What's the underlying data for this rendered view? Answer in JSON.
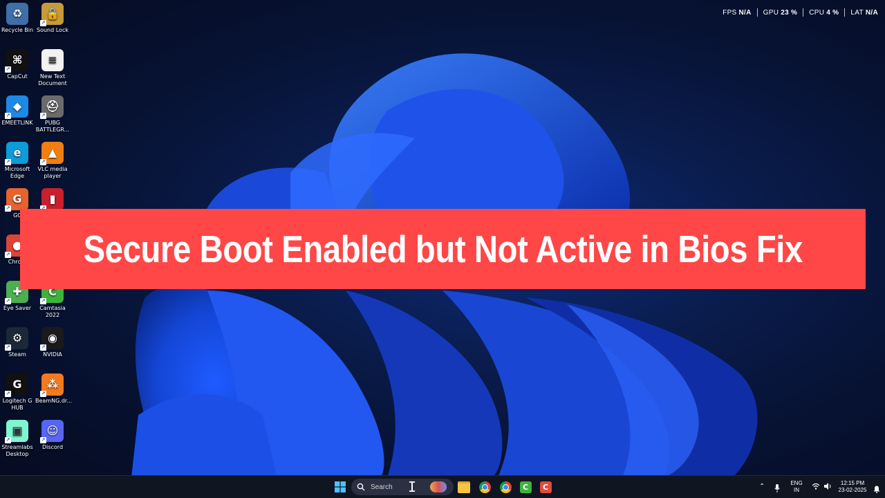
{
  "desktop": {
    "icons": [
      {
        "label": "Recycle Bin",
        "icon": "recycle-bin-icon",
        "color": "#3f6ea8"
      },
      {
        "label": "Sound Lock",
        "icon": "lock-icon",
        "color": "#c79a3a"
      },
      {
        "label": "CapCut",
        "icon": "capcut-icon",
        "color": "#111111"
      },
      {
        "label": "New Text Document",
        "icon": "text-document-icon",
        "color": "#f2f2f2"
      },
      {
        "label": "EMEETLINK",
        "icon": "emeetlink-icon",
        "color": "#1e88e5"
      },
      {
        "label": "PUBG BATTLEGR...",
        "icon": "pubg-icon",
        "color": "#6b6b6b"
      },
      {
        "label": "Microsoft Edge",
        "icon": "edge-icon",
        "color": "#0f9ad8"
      },
      {
        "label": "VLC media player",
        "icon": "vlc-icon",
        "color": "#f07f13"
      },
      {
        "label": "GC",
        "icon": "gc-icon",
        "color": "#e8622c"
      },
      {
        "label": "",
        "icon": "red-app-icon",
        "color": "#c8202c"
      },
      {
        "label": "Chrom",
        "icon": "chrome-icon",
        "color": "#db4437"
      },
      {
        "label": "Eye Saver",
        "icon": "eye-saver-icon",
        "color": "#4caf50"
      },
      {
        "label": "Camtasia 2022",
        "icon": "camtasia-icon",
        "color": "#3db33d"
      },
      {
        "label": "Steam",
        "icon": "steam-icon",
        "color": "#1b2838"
      },
      {
        "label": "NVIDIA",
        "icon": "nvidia-icon",
        "color": "#1a1a1a"
      },
      {
        "label": "Logitech G HUB",
        "icon": "logitech-g-icon",
        "color": "#111111"
      },
      {
        "label": "BeamNG.dr...",
        "icon": "beamng-icon",
        "color": "#f47a20"
      },
      {
        "label": "Streamlabs Desktop",
        "icon": "streamlabs-icon",
        "color": "#80f5d2"
      },
      {
        "label": "Discord",
        "icon": "discord-icon",
        "color": "#5865f2"
      }
    ]
  },
  "perf": {
    "fps_label": "FPS",
    "fps_value": "N/A",
    "gpu_label": "GPU",
    "gpu_value": "23 %",
    "cpu_label": "CPU",
    "cpu_value": "4 %",
    "lat_label": "LAT",
    "lat_value": "N/A"
  },
  "banner": {
    "title": "Secure Boot Enabled but Not Active in Bios Fix",
    "color": "#ff4747"
  },
  "taskbar": {
    "search_placeholder": "Search",
    "apps": [
      "windows-start-icon",
      "search-icon",
      "copilot-icon",
      "file-explorer-icon",
      "chrome-icon",
      "chrome-profile-icon",
      "camtasia-icon",
      "capcut-recorder-icon"
    ]
  },
  "tray": {
    "lang_line1": "ENG",
    "lang_line2": "IN",
    "time": "12:15 PM",
    "date": "23-02-2025"
  }
}
